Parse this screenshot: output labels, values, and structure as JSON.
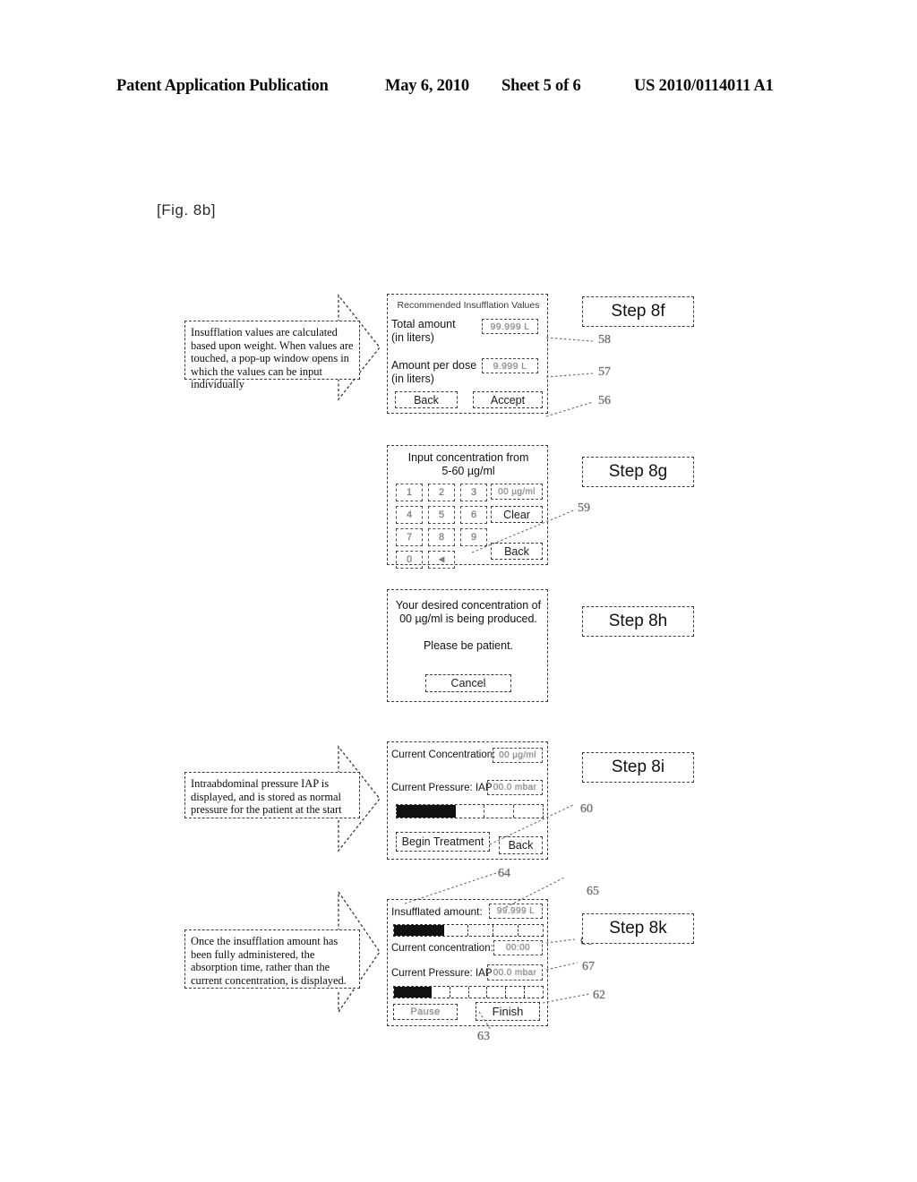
{
  "header": {
    "publication": "Patent Application Publication",
    "date": "May 6, 2010",
    "sheet": "Sheet 5 of 6",
    "patent_number": "US 2010/0114011 A1"
  },
  "figure_label": "[Fig. 8b]",
  "callouts": [
    {
      "id": "callout-8f",
      "text": "Insufflation values are calculated based upon weight. When values are touched, a pop-up window opens in which the values can be input individually"
    },
    {
      "id": "callout-8i",
      "text": "Intraabdominal pressure IAP is displayed, and is stored as normal pressure for the patient at the start"
    },
    {
      "id": "callout-8k",
      "text": "Once the insufflation amount has been fully administered, the absorption time, rather than the current concentration, is displayed."
    }
  ],
  "steps": {
    "f": "Step 8f",
    "g": "Step 8g",
    "h": "Step 8h",
    "i": "Step 8i",
    "k": "Step 8k"
  },
  "screen_8f": {
    "title": "Recommended Insufflation Values",
    "total_label_line1": "Total amount",
    "total_label_line2": "(in liters)",
    "total_value": "99.999 L",
    "dose_label_line1": "Amount per dose",
    "dose_label_line2": "(in liters)",
    "dose_value": "9.999 L",
    "back_button": "Back",
    "accept_button": "Accept"
  },
  "screen_8g": {
    "title_line1": "Input concentration from",
    "title_line2": "5-60 µg/ml",
    "display_value": "00 µg/ml",
    "keys": [
      "1",
      "2",
      "3",
      "4",
      "5",
      "6",
      "7",
      "8",
      "9",
      "0",
      "◄"
    ],
    "clear_button": "Clear",
    "back_button": "Back"
  },
  "screen_8h": {
    "line1": "Your desired concentration of",
    "line2": "00 µg/ml is being produced.",
    "line3": "Please be patient.",
    "cancel_button": "Cancel"
  },
  "screen_8i": {
    "concentration_label": "Current Concentration:",
    "concentration_value": "00 µg/ml",
    "pressure_label": "Current Pressure: IAP",
    "pressure_value": "00.0 mbar",
    "progress_segments": 5,
    "progress_filled": 2,
    "begin_button": "Begin Treatment",
    "back_button": "Back"
  },
  "screen_8k": {
    "amount_label": "Insufflated amount:",
    "amount_value": "99.999 L",
    "amount_progress_segments": 6,
    "amount_progress_filled": 2,
    "concentration_label": "Current concentration:",
    "concentration_value": "00:00",
    "pressure_label": "Current Pressure: IAP",
    "pressure_value": "00.0 mbar",
    "pressure_progress_segments": 8,
    "pressure_progress_filled": 2,
    "pause_button": "Pause",
    "finish_button": "Finish"
  },
  "reference_numerals": {
    "n58": "58",
    "n57": "57",
    "n56": "56",
    "n59": "59",
    "n60": "60",
    "n64": "64",
    "n65": "65",
    "n66": "66",
    "n67": "67",
    "n62": "62",
    "n63": "63"
  }
}
